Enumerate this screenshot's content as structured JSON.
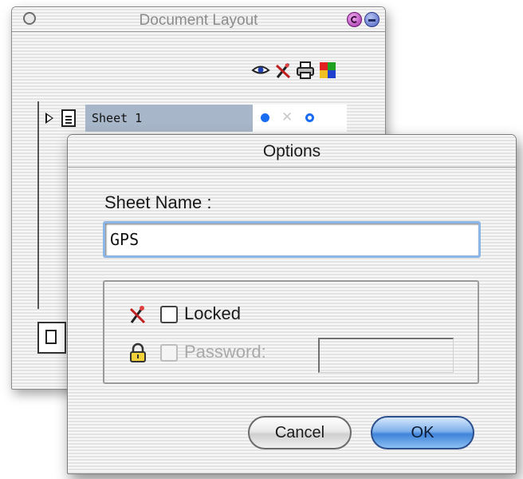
{
  "doc_window": {
    "title": "Document Layout",
    "toolbar_icons": [
      "eye-icon",
      "pencil-lock-icon",
      "printer-icon",
      "color-palette-icon"
    ],
    "sheets": [
      {
        "name": "Sheet 1",
        "visible": true,
        "locked": false,
        "printable": true
      }
    ]
  },
  "options_dialog": {
    "title": "Options",
    "sheet_name_label": "Sheet Name :",
    "sheet_name_value": "GPS",
    "locked_label": "Locked",
    "locked_checked": false,
    "password_label": "Password:",
    "password_enabled": false,
    "password_value": "",
    "cancel_label": "Cancel",
    "ok_label": "OK"
  },
  "colors": {
    "selection": "#a8b6c9",
    "accent_blue": "#1a6cf0",
    "default_button": "#3f83d9"
  }
}
